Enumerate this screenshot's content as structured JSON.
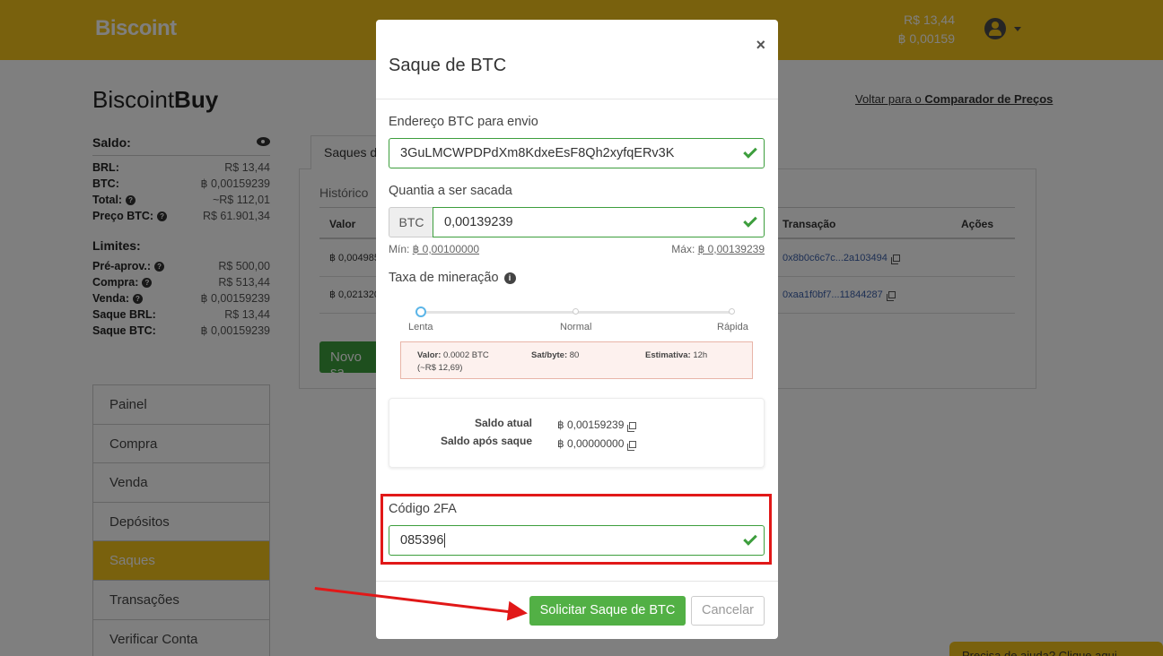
{
  "header": {
    "logo": "Biscoint",
    "balance_brl": "R$ 13,44",
    "balance_btc": "฿ 0,00159"
  },
  "page": {
    "brand_light": "Biscoint",
    "brand_bold": "Buy",
    "back_link_prefix": "Voltar para o ",
    "back_link_bold": "Comparador de Preços"
  },
  "saldo": {
    "title": "Saldo:",
    "rows": [
      {
        "k": "BRL:",
        "v": "R$ 13,44",
        "help": false
      },
      {
        "k": "BTC:",
        "v": "฿ 0,00159239",
        "help": false
      },
      {
        "k": "Total:",
        "v": "~R$ 112,01",
        "help": true
      },
      {
        "k": "Preço BTC:",
        "v": "R$ 61.901,34",
        "help": true
      }
    ]
  },
  "limites": {
    "title": "Limites:",
    "rows": [
      {
        "k": "Pré-aprov.:",
        "v": "R$ 500,00",
        "help": true
      },
      {
        "k": "Compra:",
        "v": "R$ 513,44",
        "help": true
      },
      {
        "k": "Venda:",
        "v": "฿ 0,00159239",
        "help": true
      },
      {
        "k": "Saque BRL:",
        "v": "R$ 13,44",
        "help": false
      },
      {
        "k": "Saque BTC:",
        "v": "฿ 0,00159239",
        "help": false
      }
    ]
  },
  "nav": [
    "Painel",
    "Compra",
    "Venda",
    "Depósitos",
    "Saques",
    "Transações",
    "Verificar Conta"
  ],
  "nav_active": "Saques",
  "bg_panel": {
    "tab": "Saques d",
    "history": "Histórico",
    "col_valor": "Valor",
    "col_transacao": "Transação",
    "col_acoes": "Ações",
    "rows": [
      {
        "valor": "฿ 0,004985",
        "tx": "0x8b0c6c7c...2a103494"
      },
      {
        "valor": "฿ 0,021320",
        "tx": "0xaa1f0bf7...11844287"
      }
    ],
    "new_btn": "Novo sa"
  },
  "help_tab": "Precisa de ajuda? Clique aqui",
  "modal": {
    "title": "Saque de BTC",
    "close": "×",
    "address_label": "Endereço BTC para envio",
    "address_value": "3GuLMCWPDPdXm8KdxeEsF8Qh2xyfqERv3K",
    "amount_label": "Quantia a ser sacada",
    "amount_addon": "BTC",
    "amount_value": "0,00139239",
    "min_prefix": "Mín: ",
    "min_value": "฿ 0,00100000",
    "max_prefix": "Máx: ",
    "max_value": "฿ 0,00139239",
    "fee_label": "Taxa de mineração",
    "fee_options": [
      "Lenta",
      "Normal",
      "Rápida"
    ],
    "fee_selected": "Lenta",
    "fee_valor_label": "Valor:",
    "fee_valor": "0.0002 BTC",
    "fee_valor_brl": "(~R$ 12,69)",
    "fee_sat_label": "Sat/byte:",
    "fee_sat": "80",
    "fee_est_label": "Estimativa:",
    "fee_est": "12h",
    "saldo_atual_label": "Saldo atual",
    "saldo_atual": "฿ 0,00159239",
    "saldo_apos_label": "Saldo após saque",
    "saldo_apos": "฿ 0,00000000",
    "twofa_label": "Código 2FA",
    "twofa_value": "085396",
    "submit": "Solicitar Saque de BTC",
    "cancel": "Cancelar"
  },
  "colors": {
    "brand_yellow": "#f3c21a",
    "success_green": "#52b045",
    "highlight_red": "#e11818"
  }
}
